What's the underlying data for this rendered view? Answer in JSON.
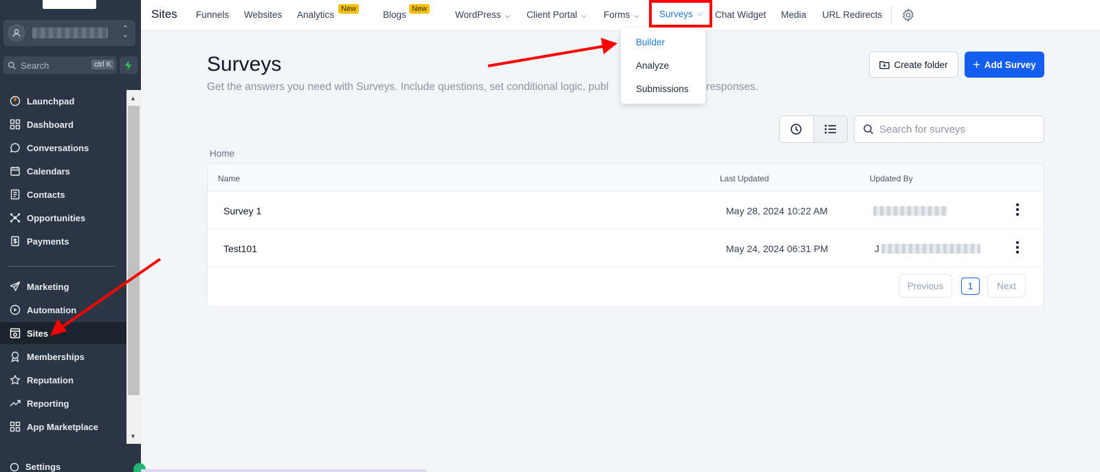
{
  "sidebar": {
    "search_placeholder": "Search",
    "search_shortcut": "ctrl K",
    "items": [
      {
        "label": "Launchpad",
        "icon": "launchpad-icon"
      },
      {
        "label": "Dashboard",
        "icon": "dashboard-icon"
      },
      {
        "label": "Conversations",
        "icon": "chat-bubble-icon"
      },
      {
        "label": "Calendars",
        "icon": "calendar-icon"
      },
      {
        "label": "Contacts",
        "icon": "contacts-icon"
      },
      {
        "label": "Opportunities",
        "icon": "opportunities-icon"
      },
      {
        "label": "Payments",
        "icon": "payments-icon"
      },
      {
        "label": "Marketing",
        "icon": "send-icon"
      },
      {
        "label": "Automation",
        "icon": "automation-icon"
      },
      {
        "label": "Sites",
        "icon": "sites-icon"
      },
      {
        "label": "Memberships",
        "icon": "award-icon"
      },
      {
        "label": "Reputation",
        "icon": "star-icon"
      },
      {
        "label": "Reporting",
        "icon": "trend-icon"
      },
      {
        "label": "App Marketplace",
        "icon": "grid-icon"
      }
    ],
    "settings_label": "Settings",
    "active_item": "Sites"
  },
  "topnav": {
    "title": "Sites",
    "tabs": [
      "Funnels",
      "Websites",
      "Analytics",
      "Blogs",
      "WordPress",
      "Client Portal",
      "Forms",
      "Surveys",
      "Chat Widget",
      "Media",
      "URL Redirects"
    ],
    "new_badge": "New",
    "active_tab": "Surveys"
  },
  "dropdown": {
    "items": [
      "Builder",
      "Analyze",
      "Submissions"
    ],
    "active": "Builder"
  },
  "main": {
    "title": "Surveys",
    "subtitle": "Get the answers you need with Surveys. Include questions, set conditional logic, publ",
    "subtitle_tail": "responses.",
    "create_folder": "Create folder",
    "add_survey": "Add Survey",
    "search_placeholder": "Search for surveys",
    "breadcrumb": "Home"
  },
  "table": {
    "headers": [
      "Name",
      "Last Updated",
      "Updated By"
    ],
    "rows": [
      {
        "name": "Survey 1",
        "updated": "May 28, 2024 10:22 AM",
        "by_initial": ""
      },
      {
        "name": "Test101",
        "updated": "May 24, 2024 06:31 PM",
        "by_initial": "J"
      }
    ]
  },
  "pagination": {
    "previous": "Previous",
    "page": "1",
    "next": "Next"
  },
  "colors": {
    "sidebar_bg": "#2a3644",
    "accent_blue": "#155eef",
    "link_blue": "#1f7ad8",
    "annotation_red": "#ff0000",
    "badge_yellow": "#f5c20b"
  }
}
